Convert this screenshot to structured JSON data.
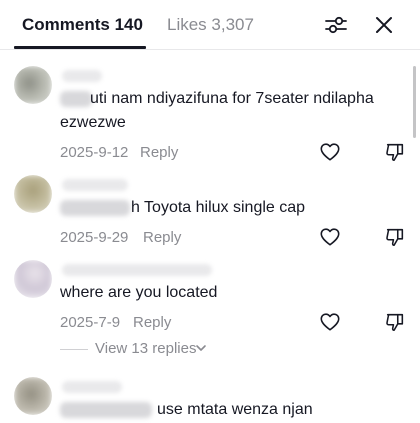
{
  "header": {
    "tab_comments": "Comments 140",
    "tab_likes": "Likes 3,307",
    "filter_icon": "sliders-icon",
    "close_icon": "close-icon"
  },
  "comments": [
    {
      "text_visible": "uti nam ndiyazifuna for 7seater ndilapha ezwezwe",
      "line1": "uti nam ndiyazifuna for 7seater ndilapha",
      "line2": "ezwezwe",
      "date": "2025-9-12",
      "reply_label": "Reply"
    },
    {
      "text_visible": "h Toyota hilux single cap",
      "date": "2025-9-29",
      "reply_label": "Reply"
    },
    {
      "text_visible": "where are you located",
      "date": "2025-7-9",
      "reply_label": "Reply",
      "view_replies": "View 13 replies"
    },
    {
      "text_visible": "use mtata wenza njan"
    }
  ],
  "colors": {
    "text_primary": "#161823",
    "text_secondary": "#8a8b91",
    "divider": "#e8e8ea"
  }
}
